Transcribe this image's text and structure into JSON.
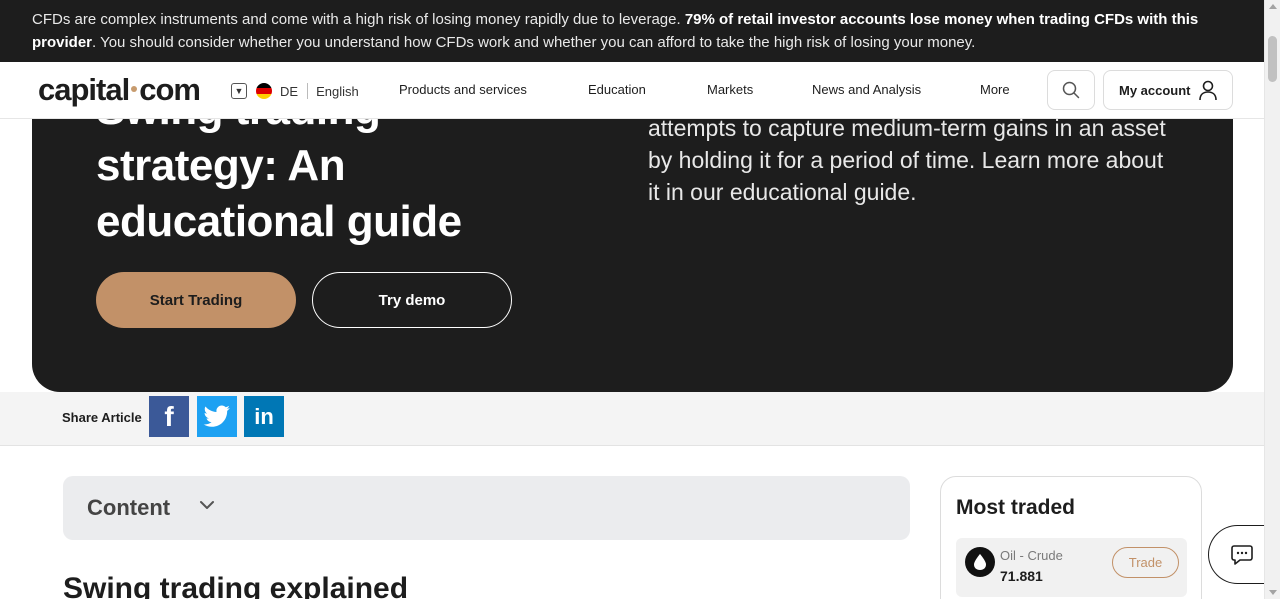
{
  "risk_banner": {
    "text_start": "CFDs are complex instruments and come with a high risk of losing money rapidly due to leverage. ",
    "text_bold": "79% of retail investor accounts lose money when trading CFDs with this provider",
    "text_end": ". You should consider whether you understand how CFDs work and whether you can afford to take the high risk of losing your money."
  },
  "header": {
    "logo_left": "capital",
    "logo_right": "com",
    "country_code": "DE",
    "language": "English",
    "nav": [
      "Products and services",
      "Education",
      "Markets",
      "News and Analysis",
      "More"
    ],
    "account_label": "My account",
    "icons": {
      "search": "search-icon",
      "account": "user-icon",
      "language_toggle": "chevron-down-icon"
    },
    "flag_colors": [
      "#000000",
      "#dd0000",
      "#ffce00"
    ]
  },
  "hero": {
    "title_line1": "Swing trading",
    "title_line2": "strategy: An",
    "title_line3": "educational guide",
    "description": "attempts to capture medium-term gains in an asset by holding it for a period of time. Learn more about it in our educational guide.",
    "start_button": "Start Trading",
    "demo_button": "Try demo"
  },
  "share": {
    "label": "Share Article",
    "buttons": [
      "f",
      "twitter",
      "in"
    ]
  },
  "content": {
    "accordion_label": "Content",
    "section_heading": "Swing trading explained"
  },
  "sidebar": {
    "title": "Most traded",
    "assets": [
      {
        "name": "Oil - Crude",
        "price": "71.881",
        "trade_label": "Trade"
      }
    ]
  },
  "colors": {
    "accent": "#c29168",
    "dark": "#1d1d1d",
    "facebook": "#3b5998",
    "twitter": "#1da1f2",
    "linkedin": "#0077b5"
  }
}
